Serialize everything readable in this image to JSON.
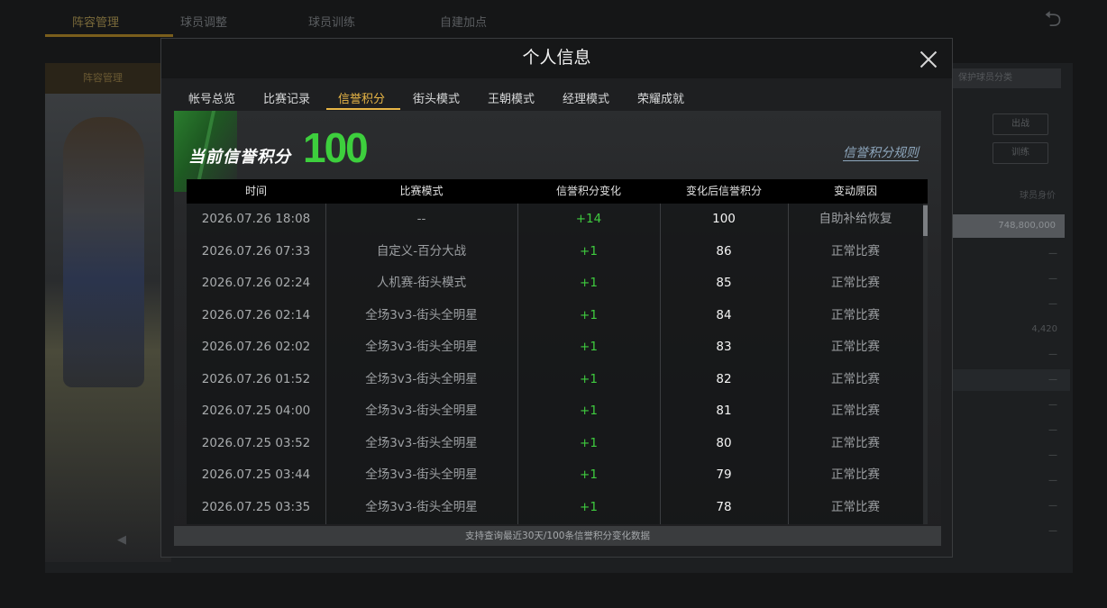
{
  "background": {
    "top_tabs": [
      "阵容管理",
      "球员调整",
      "球员训练",
      "自建加点"
    ],
    "sub_tab": "阵容管理",
    "select_label": "保护球员分类",
    "buttons": [
      "出战",
      "训练"
    ],
    "stat_label": "球员身价",
    "money": "748,800,000",
    "stat_values": [
      "—",
      "—",
      "—",
      "4,420",
      "—",
      "—",
      "—",
      "—",
      "—",
      "—",
      "—",
      "—"
    ],
    "back_icon": "return-icon",
    "nav_arrow": "◀"
  },
  "dialog": {
    "title": "个人信息",
    "close_icon": "close-icon",
    "tabs": [
      "帐号总览",
      "比赛记录",
      "信誉积分",
      "街头模式",
      "王朝模式",
      "经理模式",
      "荣耀成就"
    ],
    "active_tab": "信誉积分",
    "score_label": "当前信誉积分",
    "score_value": "100",
    "rules_link": "信誉积分规则",
    "columns": [
      "时间",
      "比赛模式",
      "信誉积分变化",
      "变化后信誉积分",
      "变动原因"
    ],
    "rows": [
      {
        "time": "2026.07.26  18:08",
        "mode": "--",
        "change": "+14",
        "after": "100",
        "reason": "自助补给恢复"
      },
      {
        "time": "2026.07.26  07:33",
        "mode": "自定义-百分大战",
        "change": "+1",
        "after": "86",
        "reason": "正常比赛"
      },
      {
        "time": "2026.07.26  02:24",
        "mode": "人机赛-街头模式",
        "change": "+1",
        "after": "85",
        "reason": "正常比赛"
      },
      {
        "time": "2026.07.26  02:14",
        "mode": "全场3v3-街头全明星",
        "change": "+1",
        "after": "84",
        "reason": "正常比赛"
      },
      {
        "time": "2026.07.26  02:02",
        "mode": "全场3v3-街头全明星",
        "change": "+1",
        "after": "83",
        "reason": "正常比赛"
      },
      {
        "time": "2026.07.26  01:52",
        "mode": "全场3v3-街头全明星",
        "change": "+1",
        "after": "82",
        "reason": "正常比赛"
      },
      {
        "time": "2026.07.25  04:00",
        "mode": "全场3v3-街头全明星",
        "change": "+1",
        "after": "81",
        "reason": "正常比赛"
      },
      {
        "time": "2026.07.25  03:52",
        "mode": "全场3v3-街头全明星",
        "change": "+1",
        "after": "80",
        "reason": "正常比赛"
      },
      {
        "time": "2026.07.25  03:44",
        "mode": "全场3v3-街头全明星",
        "change": "+1",
        "after": "79",
        "reason": "正常比赛"
      },
      {
        "time": "2026.07.25  03:35",
        "mode": "全场3v3-街头全明星",
        "change": "+1",
        "after": "78",
        "reason": "正常比赛"
      }
    ],
    "footer": "支持查询最近30天/100条信誉积分变化数据"
  },
  "colors": {
    "accent_tab": "#e8b646",
    "score_green": "#3dcf3d",
    "change_green": "#3fcb3f",
    "link_blue": "#8ea7bd"
  }
}
